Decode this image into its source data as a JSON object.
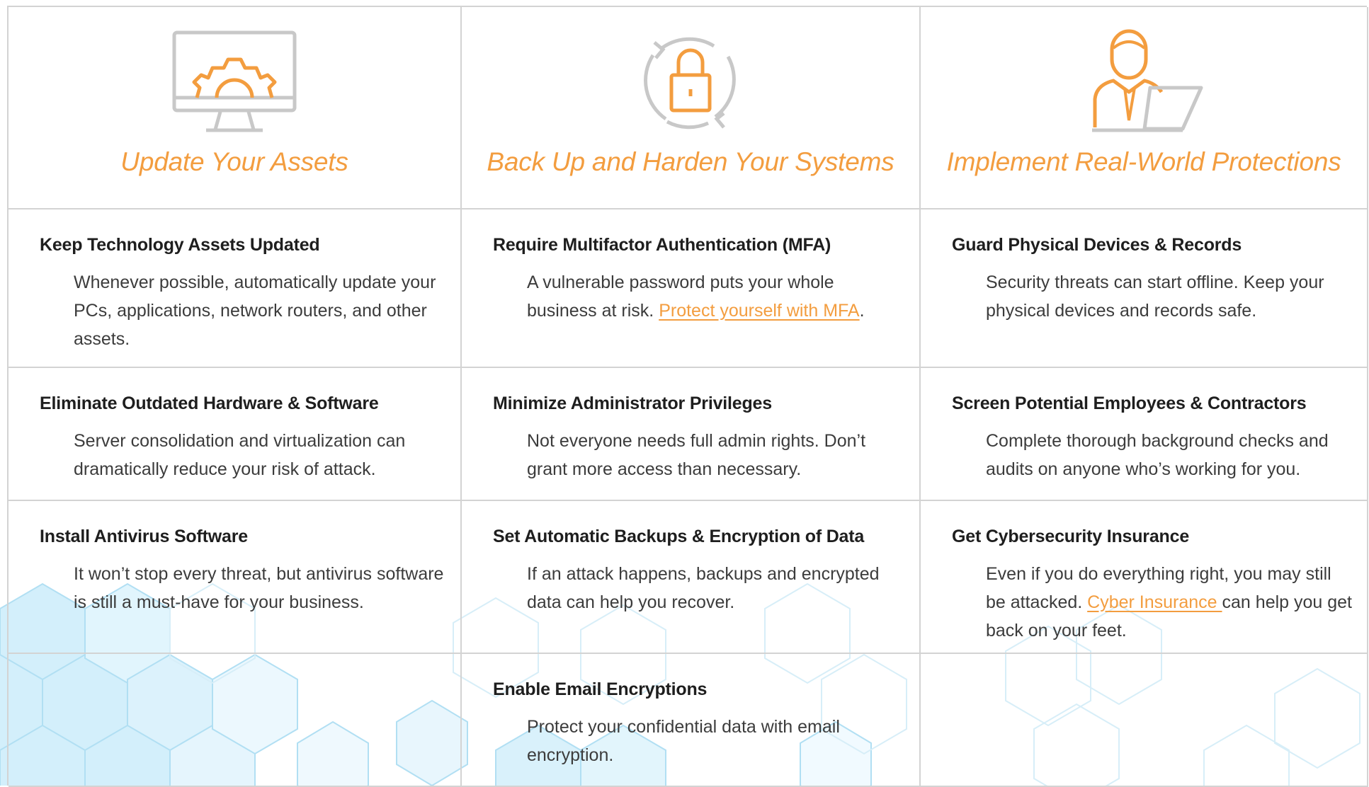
{
  "columns": [
    {
      "title": "Update Your Assets",
      "icon": "monitor-gear-icon",
      "items": [
        {
          "title": "Keep Technology Assets Updated",
          "desc": "Whenever possible, automatically update your PCs, applications, network routers, and other assets."
        },
        {
          "title": "Eliminate Outdated Hardware & Software",
          "desc": "Server consolidation and virtualization can dramatically reduce your risk of attack."
        },
        {
          "title": "Install Antivirus Software",
          "desc": "It won’t stop every threat, but antivirus software is still a must-have for your business."
        }
      ]
    },
    {
      "title": "Back Up and Harden Your Systems",
      "icon": "lock-refresh-icon",
      "items": [
        {
          "title": "Require Multifactor Authentication (MFA)",
          "desc_before": "A vulnerable password puts your whole business at risk. ",
          "link": "Protect yourself with MFA",
          "desc_after": "."
        },
        {
          "title": "Minimize Administrator Privileges",
          "desc": "Not everyone needs full admin rights. Don’t grant more access than necessary."
        },
        {
          "title": "Set Automatic Backups & Encryption of Data",
          "desc": "If an attack happens, backups and encrypted data can help you recover."
        },
        {
          "title": "Enable Email Encryptions",
          "desc": "Protect your confidential data with email encryption."
        }
      ]
    },
    {
      "title": "Implement Real-World Protections",
      "icon": "person-laptop-icon",
      "items": [
        {
          "title": "Guard Physical Devices & Records",
          "desc": "Security threats can start offline. Keep your physical devices and records safe."
        },
        {
          "title": "Screen Potential Employees & Contractors",
          "desc": "Complete thorough background checks and audits on anyone who’s working for you."
        },
        {
          "title": "Get Cybersecurity Insurance",
          "desc_before": "Even if you do everything right, you may still be attacked. ",
          "link": "Cyber Insurance ",
          "desc_after": "can help you get back on your feet."
        }
      ]
    }
  ],
  "colors": {
    "accent": "#f39d3f",
    "icon_gray": "#c4c4c4",
    "grid_line": "#d3d3d3",
    "hex_bg": "#bfe6f7"
  }
}
